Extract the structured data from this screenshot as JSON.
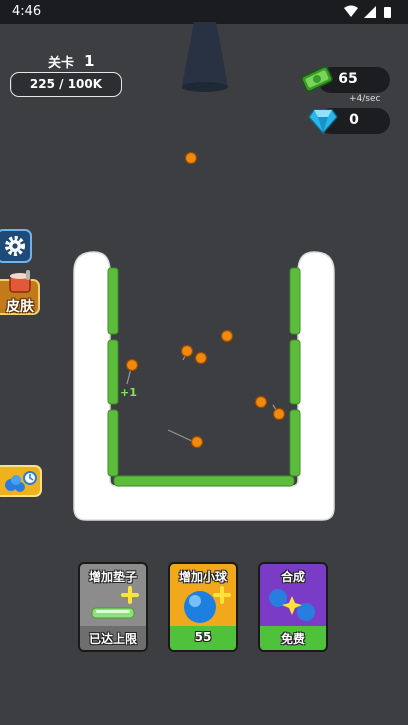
{
  "status_bar": {
    "time": "4:46"
  },
  "level": {
    "label": "关卡",
    "number": "1"
  },
  "progress": {
    "text": "225 / 100K",
    "fraction": 0.00225
  },
  "currency": {
    "money": "65",
    "rate": "+4/sec",
    "gems": "0"
  },
  "side_buttons": {
    "skin_label": "皮肤"
  },
  "board": {
    "bonus_text": "+1"
  },
  "cards": [
    {
      "title": "增加垫子",
      "footer": "已达上限",
      "color": "#8c8c8c",
      "footer_color": "#6e6e6e"
    },
    {
      "title": "增加小球",
      "footer": "55",
      "color": "#f2a81c",
      "footer_color": "#4fc13a"
    },
    {
      "title": "合成",
      "footer": "免费",
      "color": "#7a3bc7",
      "footer_color": "#4fc13a"
    }
  ],
  "colors": {
    "background": "#3d3e42",
    "paddle": "#5cbd3c",
    "ball": "#f08a0e",
    "container": "#ffffff"
  }
}
